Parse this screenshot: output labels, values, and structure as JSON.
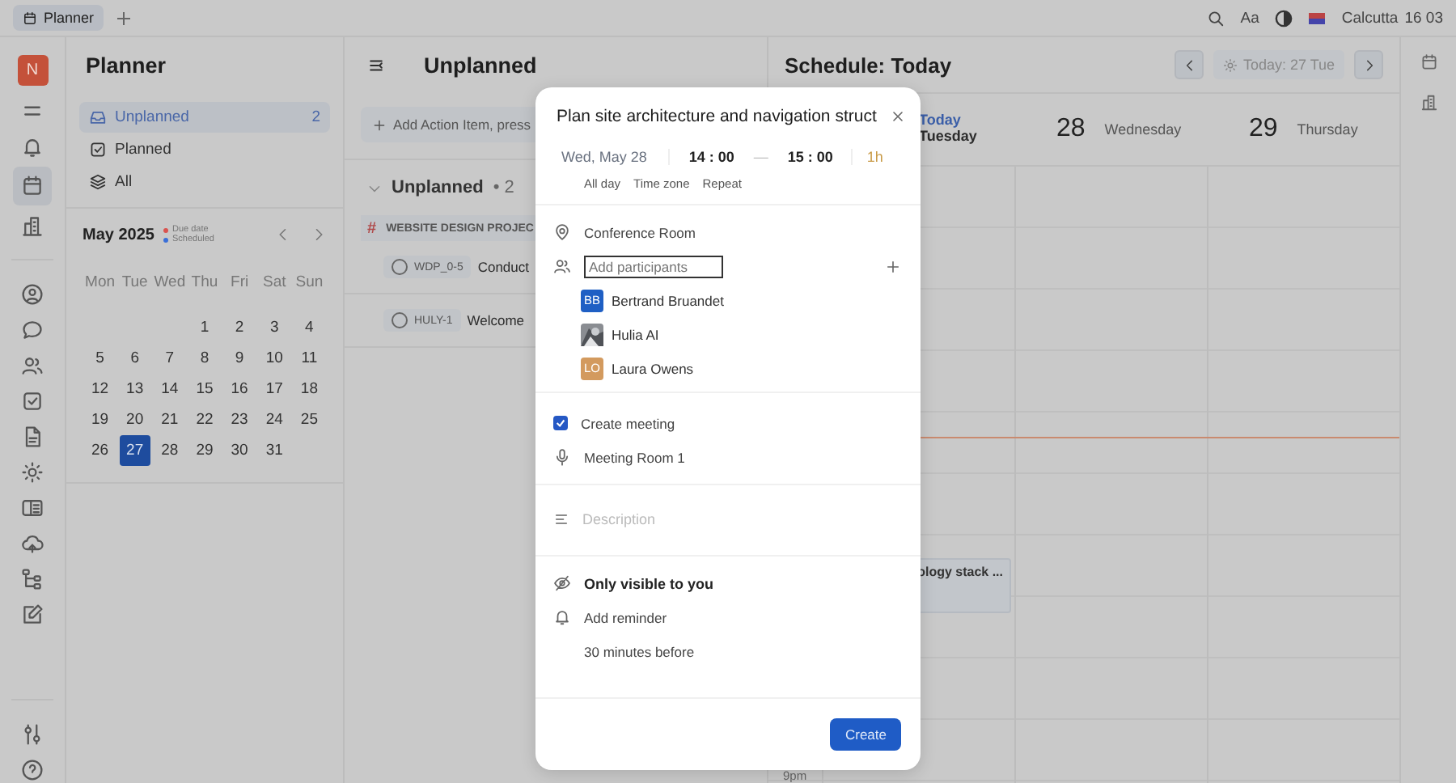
{
  "top_bar": {
    "tabs": [
      {
        "label": "Planner",
        "selected": true
      }
    ],
    "font_button": "Aa",
    "city": "Calcutta",
    "time": "16 03"
  },
  "rail": {
    "avatar": "N",
    "items": [
      {
        "kind": "menu",
        "selected": false
      },
      {
        "kind": "bell",
        "selected": false
      },
      {
        "kind": "calendar",
        "selected": true
      },
      {
        "kind": "chart",
        "selected": false
      },
      {
        "kind": "person",
        "selected": false
      },
      {
        "kind": "chat",
        "selected": false
      },
      {
        "kind": "people",
        "selected": false
      },
      {
        "kind": "check",
        "selected": false
      },
      {
        "kind": "doc",
        "selected": false
      },
      {
        "kind": "sun",
        "selected": false
      },
      {
        "kind": "book",
        "selected": false
      },
      {
        "kind": "cloud",
        "selected": false
      },
      {
        "kind": "tree",
        "selected": false
      },
      {
        "kind": "edit",
        "selected": false
      }
    ],
    "bottom": [
      {
        "kind": "sliders",
        "selected": false
      },
      {
        "kind": "help",
        "selected": false
      }
    ]
  },
  "planner": {
    "title": "Planner",
    "nav": [
      {
        "kind": "inbox",
        "label": "Unplanned",
        "count": "2",
        "selected": true
      },
      {
        "kind": "check",
        "label": "Planned",
        "selected": false
      },
      {
        "kind": "layers",
        "label": "All",
        "selected": false
      }
    ],
    "calendar": {
      "month": "May 2025",
      "legend": [
        {
          "label": "Due date",
          "color": "#d9534f"
        },
        {
          "label": "Scheduled",
          "color": "#3a6fd8"
        }
      ],
      "weekdays": [
        "Mon",
        "Tue",
        "Wed",
        "Thu",
        "Fri",
        "Sat",
        "Sun"
      ],
      "weeks": [
        [
          {
            "day": "1",
            "selected": false
          },
          {
            "day": "2",
            "selected": false
          },
          {
            "day": "3",
            "selected": false
          },
          {
            "day": "4",
            "selected": false
          }
        ],
        [
          {
            "day": "5",
            "selected": false
          },
          {
            "day": "6",
            "selected": false
          },
          {
            "day": "7",
            "selected": false
          },
          {
            "day": "8",
            "selected": false
          },
          {
            "day": "9",
            "selected": false
          },
          {
            "day": "10",
            "selected": false
          },
          {
            "day": "11",
            "selected": false
          }
        ],
        [
          {
            "day": "12",
            "selected": false
          },
          {
            "day": "13",
            "selected": false
          },
          {
            "day": "14",
            "selected": false
          },
          {
            "day": "15",
            "selected": false
          },
          {
            "day": "16",
            "selected": false
          },
          {
            "day": "17",
            "selected": false
          },
          {
            "day": "18",
            "selected": false
          }
        ],
        [
          {
            "day": "19",
            "selected": false
          },
          {
            "day": "20",
            "selected": false
          },
          {
            "day": "21",
            "selected": false
          },
          {
            "day": "22",
            "selected": false
          },
          {
            "day": "23",
            "selected": false
          },
          {
            "day": "24",
            "selected": false
          },
          {
            "day": "25",
            "selected": false
          }
        ],
        [
          {
            "day": "26",
            "selected": false
          },
          {
            "day": "27",
            "selected": true
          },
          {
            "day": "28",
            "selected": false
          },
          {
            "day": "29",
            "selected": false
          },
          {
            "day": "30",
            "selected": false
          },
          {
            "day": "31",
            "selected": false
          }
        ]
      ]
    }
  },
  "unplanned": {
    "title": "Unplanned",
    "add_button": "Add Action Item, press",
    "group": {
      "label": "Unplanned",
      "separator": "•",
      "count": "2",
      "expanded": true
    },
    "project_mark": "#",
    "project": "WEBSITE DESIGN PROJEC",
    "items": [
      {
        "id": "WDP_0-5",
        "title": "Conduct"
      },
      {
        "id": "HULY-1",
        "title": "Welcome"
      }
    ]
  },
  "schedule": {
    "title": "Schedule: Today",
    "today_button": "Today: 27 Tue",
    "days": [
      {
        "kind": "today",
        "label": "Today",
        "weekday": "Tuesday"
      },
      {
        "kind": "day",
        "number": "28",
        "weekday": "Wednesday"
      },
      {
        "kind": "day",
        "number": "29",
        "weekday": "Thursday"
      }
    ],
    "events": [
      {
        "title": "ology stack ..."
      }
    ],
    "time_labels": [
      "9pm"
    ]
  },
  "modal": {
    "title": "Plan site architecture and navigation struct",
    "date": "Wed, May 28",
    "start": "14 : 00",
    "dash": "—",
    "end": "15 : 00",
    "duration": "1h",
    "options": [
      "All day",
      "Time zone",
      "Repeat"
    ],
    "location": "Conference Room",
    "participants_placeholder": "Add participants",
    "people": [
      {
        "kind": "initials",
        "initials": "BB",
        "name": "Bertrand Bruandet",
        "color": "#1f5fc4"
      },
      {
        "kind": "picture",
        "name": "Hulia AI"
      },
      {
        "kind": "initials",
        "initials": "LO",
        "name": "Laura Owens",
        "color": "#d39a5e"
      }
    ],
    "create_meeting": {
      "label": "Create meeting",
      "checked": true
    },
    "room": "Meeting Room 1",
    "description_placeholder": "Description",
    "visibility": "Only visible to you",
    "reminder": "Add reminder",
    "reminder_time": "30 minutes before",
    "create_button": "Create"
  }
}
